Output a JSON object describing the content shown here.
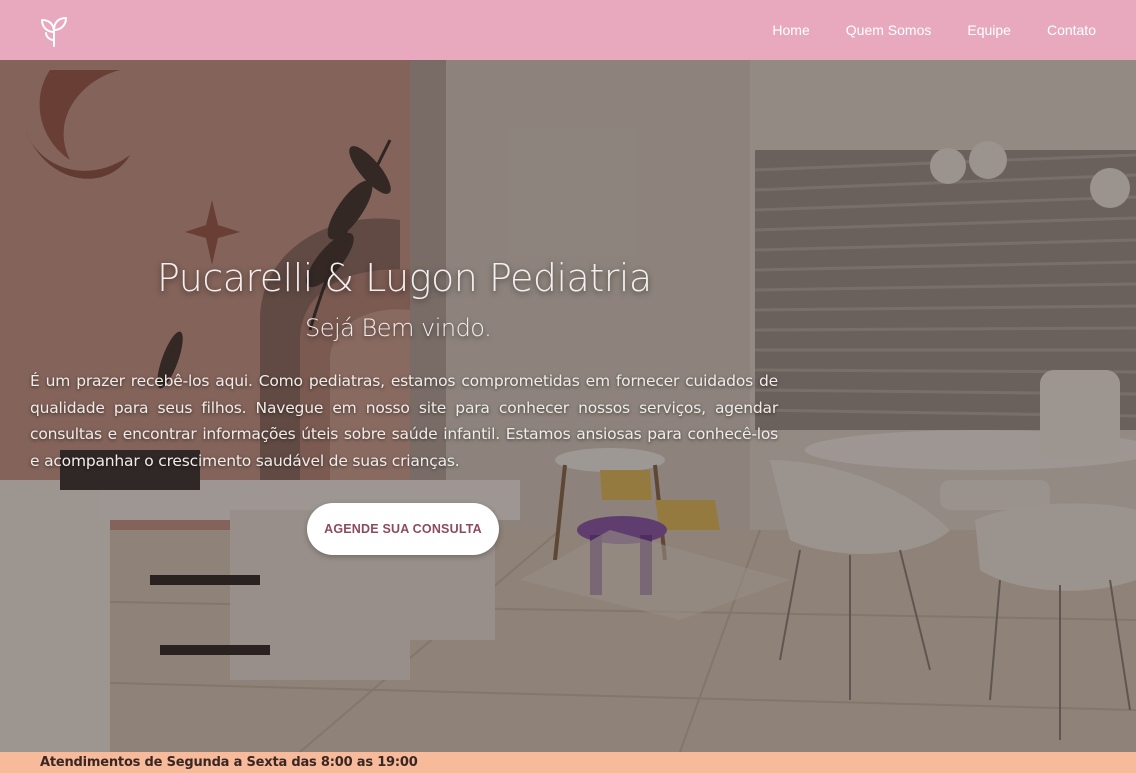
{
  "nav": {
    "logo_icon": "sprout-icon",
    "links": [
      {
        "label": "Home"
      },
      {
        "label": "Quem Somos"
      },
      {
        "label": "Equipe"
      },
      {
        "label": "Contato"
      }
    ]
  },
  "hero": {
    "title": "Pucarelli & Lugon Pediatria",
    "subtitle": "Sejá Bem vindo.",
    "body": "É um prazer recebê-los aqui. Como pediatras, estamos comprometidas em fornecer cuidados de qualidade para seus filhos. Navegue em nosso site para conhecer nossos serviços, agendar consultas e encontrar informações úteis sobre saúde infantil. Estamos ansiosas para conhecê-los e acompanhar o crescimento saudável de suas crianças.",
    "cta_label": "AGENDE SUA CONSULTA",
    "background_icon": "pediatric-office-photo"
  },
  "footer": {
    "hours": "Atendimentos de Segunda a Sexta das 8:00 as 19:00"
  },
  "colors": {
    "nav_bg": "#e8a9be",
    "footer_bg": "#f7ba9b",
    "cta_text": "#8e4a5e"
  }
}
